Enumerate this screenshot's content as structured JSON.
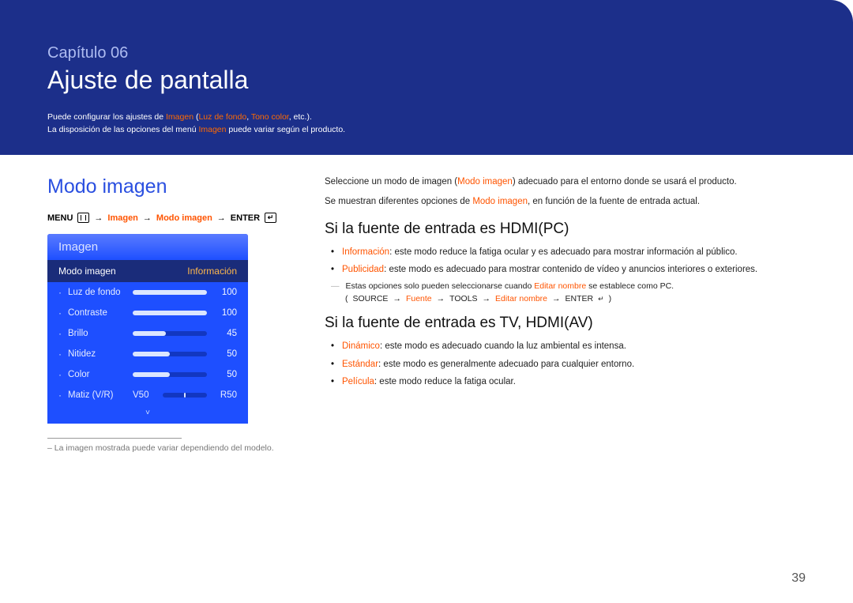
{
  "header": {
    "chapter_label": "Capítulo 06",
    "chapter_title": "Ajuste de pantalla",
    "intro1_prefix": "Puede configurar los ajustes de ",
    "intro1_hl1": "Imagen",
    "intro1_mid": " (",
    "intro1_hl2": "Luz de fondo",
    "intro1_sep": ", ",
    "intro1_hl3": "Tono color",
    "intro1_suffix": ", etc.).",
    "intro2_prefix": "La disposición de las opciones del menú ",
    "intro2_hl": "Imagen",
    "intro2_suffix": " puede variar según el producto."
  },
  "left": {
    "section_title": "Modo imagen",
    "bc_menu": "MENU",
    "bc_arrow": "→",
    "bc_imagen": "Imagen",
    "bc_modo": "Modo imagen",
    "bc_enter": "ENTER",
    "osd_title": "Imagen",
    "osd_selected_label": "Modo imagen",
    "osd_selected_value": "Información",
    "rows": [
      {
        "label": "Luz de fondo",
        "value": "100",
        "fill": 100
      },
      {
        "label": "Contraste",
        "value": "100",
        "fill": 100
      },
      {
        "label": "Brillo",
        "value": "45",
        "fill": 45
      },
      {
        "label": "Nitidez",
        "value": "50",
        "fill": 50
      },
      {
        "label": "Color",
        "value": "50",
        "fill": 50
      }
    ],
    "matiz_label": "Matiz (V/R)",
    "matiz_v": "V50",
    "matiz_r": "R50",
    "caret": "˅",
    "footnote_prefix": "– ",
    "footnote": "La imagen mostrada puede variar dependiendo del modelo."
  },
  "right": {
    "p1_a": "Seleccione un modo de imagen (",
    "p1_hl": "Modo imagen",
    "p1_b": ") adecuado para el entorno donde se usará el producto.",
    "p2_a": "Se muestran diferentes opciones de ",
    "p2_hl": "Modo imagen",
    "p2_b": ", en función de la fuente de entrada actual.",
    "sub1_title": "Si la fuente de entrada es HDMI(PC)",
    "sub1_li1_hl": "Información",
    "sub1_li1_txt": ": este modo reduce la fatiga ocular y es adecuado para mostrar información al público.",
    "sub1_li2_hl": "Publicidad",
    "sub1_li2_txt": ": este modo es adecuado para mostrar contenido de vídeo y anuncios interiores o exteriores.",
    "note_dash": "―",
    "note_a": "Estas opciones solo pueden seleccionarse cuando ",
    "note_hl": "Editar nombre",
    "note_b": " se establece como PC.",
    "path_open": "(",
    "path_source": "SOURCE",
    "path_arrow": "→",
    "path_fuente": "Fuente",
    "path_tools": "TOOLS",
    "path_editar": "Editar nombre",
    "path_enter": "ENTER",
    "path_close": ")",
    "sub2_title": "Si la fuente de entrada es TV, HDMI(AV)",
    "sub2_li1_hl": "Dinámico",
    "sub2_li1_txt": ": este modo es adecuado cuando la luz ambiental es intensa.",
    "sub2_li2_hl": "Estándar",
    "sub2_li2_txt": ": este modo es generalmente adecuado para cualquier entorno.",
    "sub2_li3_hl": "Película",
    "sub2_li3_txt": ": este modo reduce la fatiga ocular."
  },
  "page_number": "39"
}
